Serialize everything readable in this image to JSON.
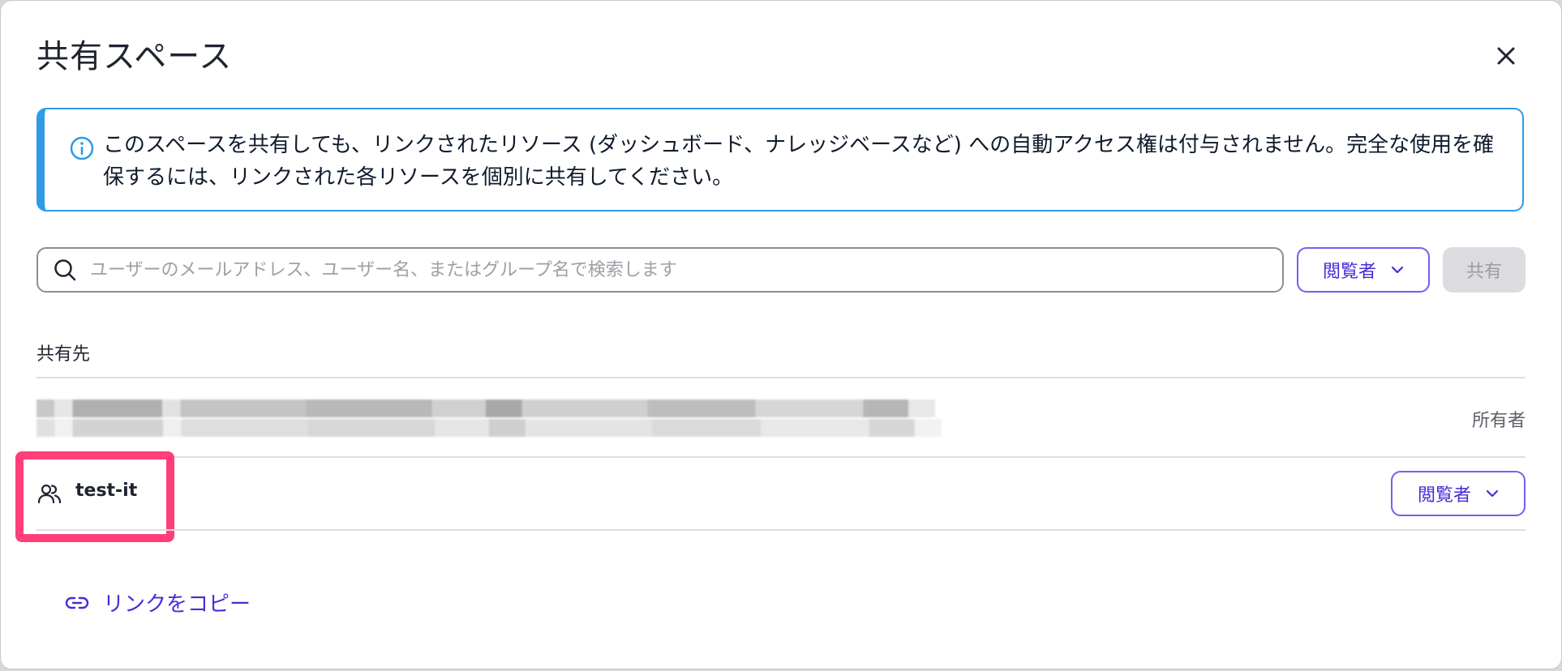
{
  "dialog": {
    "title": "共有スペース",
    "close_icon": "close-icon"
  },
  "info": {
    "icon": "info-icon",
    "text": "このスペースを共有しても、リンクされたリソース (ダッシュボード、ナレッジベースなど) への自動アクセス権は付与されません。完全な使用を確保するには、リンクされた各リソースを個別に共有してください。"
  },
  "search": {
    "icon": "search-icon",
    "placeholder": "ユーザーのメールアドレス、ユーザー名、またはグループ名で検索します",
    "value": ""
  },
  "role_select": {
    "selected": "閲覧者",
    "icon": "chevron-down-icon"
  },
  "share_button": {
    "label": "共有",
    "disabled": true
  },
  "shared_with": {
    "heading": "共有先",
    "entries": [
      {
        "name": "",
        "role": "所有者",
        "redacted": true
      },
      {
        "name": "test-it",
        "icon": "group-icon",
        "role": "閲覧者"
      }
    ]
  },
  "copy_link": {
    "icon": "link-icon",
    "label": "リンクをコピー"
  },
  "colors": {
    "accent": "#4b2bd6",
    "info_border": "#2f9be8",
    "highlight": "#ff3e7a",
    "disabled_bg": "#dcdce0"
  }
}
